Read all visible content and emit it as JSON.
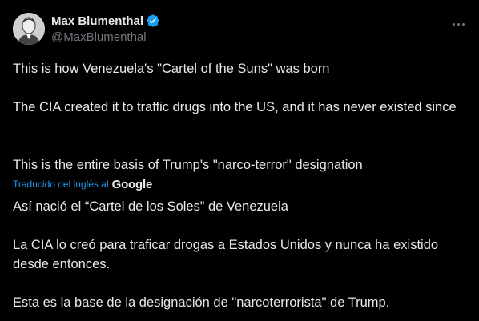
{
  "author": {
    "display_name": "Max Blumenthal",
    "handle": "@MaxBlumenthal",
    "verified": true,
    "avatar_icon": "person-avatar"
  },
  "menu": {
    "icon": "more-horizontal-icon"
  },
  "tweet": {
    "paragraphs": [
      "This is how Venezuela's \"Cartel of the Suns\" was born",
      "The CIA created it to traffic drugs into the US, and it has never existed since",
      "This is the entire basis of Trump's \"narco-terror\" designation"
    ]
  },
  "translation": {
    "label": "Traducido del inglés al",
    "provider": "Google",
    "paragraphs": [
      "Así nació el “Cartel de los Soles” de Venezuela",
      "La CIA lo creó para traficar drogas a Estados Unidos y nunca ha existido desde entonces.",
      "Esta es la base de la designación de \"narcoterrorista\" de Trump."
    ]
  },
  "colors": {
    "background": "#000000",
    "text_primary": "#e7e9ea",
    "text_secondary": "#71767b",
    "accent": "#1d9bf0"
  }
}
